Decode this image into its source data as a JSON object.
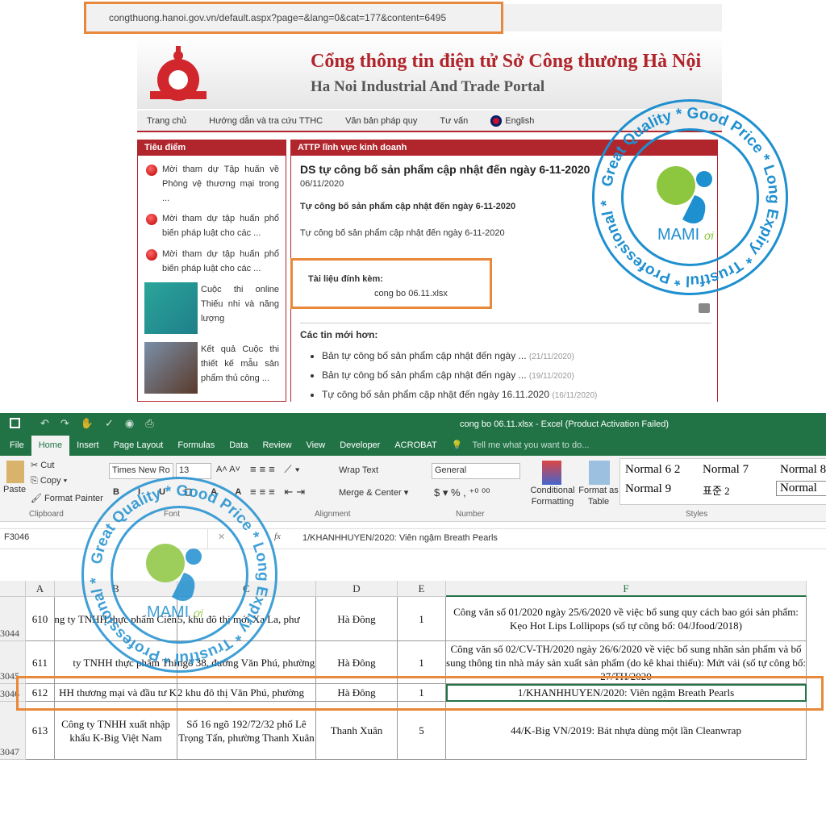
{
  "browser": {
    "url": "congthuong.hanoi.gov.vn/default.aspx?page=&lang=0&cat=177&content=6495"
  },
  "site": {
    "title": "Cổng thông tin điện tử Sở Công thương Hà Nội",
    "subtitle": "Ha Noi Industrial And Trade Portal",
    "nav": [
      "Trang chủ",
      "Hướng dẫn và tra cứu TTHC",
      "Văn bản pháp quy",
      "Tư vấn",
      "English"
    ],
    "left_panel": {
      "title": "Tiêu điểm",
      "items": [
        "Mời tham dự Tập huấn về Phòng vệ thương mại trong ...",
        "Mời tham dự tập huấn phổ biến pháp luật cho các ...",
        "Mời tham dự tập huấn phổ biến pháp luật cho các ...",
        "Cuộc thi online Thiếu nhi và năng lượng",
        "Kết quả Cuộc thi thiết kế mẫu sản phẩm thủ công ..."
      ]
    },
    "article": {
      "section": "ATTP lĩnh vực kinh doanh",
      "title": "DS tự công bố sản phẩm cập nhật đến ngày 6-11-2020",
      "date": "06/11/2020",
      "lead": "Tự công bố sản phẩm cập nhật đến ngày 6-11-2020",
      "body": "Tự công bố sản phẩm cập nhật đến ngày 6-11-2020",
      "attach_label": "Tài liệu đính kèm:",
      "attach_file": "cong bo 06.11.xlsx",
      "newer_label": "Các tin mới hơn:",
      "newer": [
        {
          "t": "Bản tự công bố sản phẩm cập nhật đến ngày ...",
          "d": "(21/11/2020)"
        },
        {
          "t": "Bản tự công bố sản phẩm cập nhật đến ngày ...",
          "d": "(19/11/2020)"
        },
        {
          "t": "Tự công bố sản phẩm cập nhật đến ngày 16.11.2020",
          "d": "(16/11/2020)"
        }
      ]
    }
  },
  "stamp": {
    "brand": "MAMI ơi",
    "ring": "Great Quality * Good Price * Long Expiry * Trustful * Professional * Authentic *",
    "colors": {
      "blue": "#1e8fcf",
      "green": "#8dc63f"
    }
  },
  "excel": {
    "title": "cong bo 06.11.xlsx - Excel (Product Activation Failed)",
    "tabs": [
      "File",
      "Home",
      "Insert",
      "Page Layout",
      "Formulas",
      "Data",
      "Review",
      "View",
      "Developer",
      "ACROBAT"
    ],
    "tell_me": "Tell me what you want to do...",
    "ribbon": {
      "paste": "Paste",
      "cut": "Cut",
      "copy": "Copy",
      "format_painter": "Format Painter",
      "clipboard": "Clipboard",
      "font_name": "Times New Ro",
      "font_size": "13",
      "font": "Font",
      "wrap": "Wrap Text",
      "merge": "Merge & Center",
      "alignment": "Alignment",
      "number_format": "General",
      "number": "Number",
      "cond": "Conditional Formatting",
      "fmt_table": "Format as Table",
      "styles": "Styles",
      "style_items": [
        "Normal 6 2",
        "Normal 7",
        "Normal 8",
        "Normal 9",
        "표준 2",
        "Normal"
      ]
    },
    "name_box": "F3046",
    "formula": "1/KHANHHUYEN/2020: Viên ngậm Breath Pearls",
    "columns": [
      "A",
      "B",
      "C",
      "D",
      "E",
      "F"
    ],
    "rows": [
      {
        "n": "3044",
        "a": "610",
        "b": "ng ty TNHH thực phẩm Ciến",
        "c": "5, khu đô thị mới Xa La, phư",
        "d": "Hà Đông",
        "e": "1",
        "f": "Công văn số 01/2020 ngày 25/6/2020  về việc bổ sung quy cách bao gói sản phẩm: Kẹo Hot Lips Lollipops (số tự công bố: 04/Jfood/2018)"
      },
      {
        "n": "3045",
        "a": "611",
        "b": "ty TNHH thực phẩm Thi",
        "c": "ngõ 38, đường Văn Phú, phường",
        "d": "Hà Đông",
        "e": "1",
        "f": "Công văn số 02/CV-TH/2020 ngày 26/6/2020 về việc bổ sung nhãn sản phẩm và bổ sung thông tin nhà máy sản xuất sản phẩm (do kê khai thiếu): Mứt vải (số tự công bố: 27/TH/2020"
      },
      {
        "n": "3046",
        "a": "612",
        "b": "HH thương mại và đầu tư K",
        "c": "2 khu đô thị Văn Phú, phường",
        "d": "Hà Đông",
        "e": "1",
        "f": "1/KHANHHUYEN/2020: Viên ngậm Breath Pearls"
      },
      {
        "n": "3047",
        "a": "613",
        "b": "Công ty TNHH xuất nhập khẩu K-Big Việt Nam",
        "c": "Số 16 ngõ 192/72/32 phố Lê Trọng Tấn, phường Thanh Xuân",
        "d": "Thanh Xuân",
        "e": "5",
        "f": "44/K-Big VN/2019: Bát nhựa dùng một lần Cleanwrap"
      }
    ]
  }
}
